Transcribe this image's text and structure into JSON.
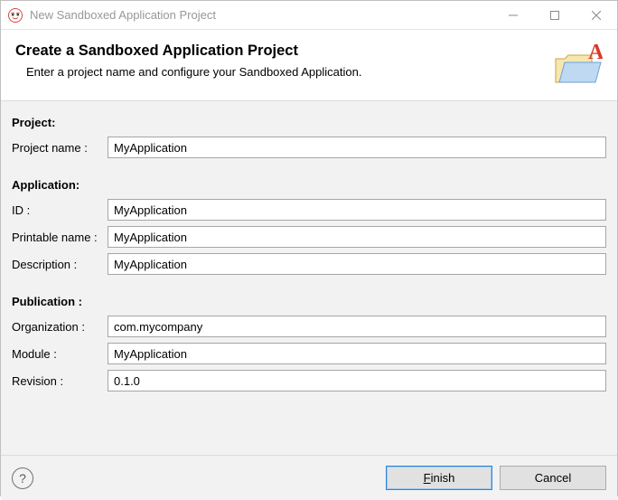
{
  "window": {
    "title": "New Sandboxed Application Project"
  },
  "header": {
    "title": "Create a Sandboxed Application Project",
    "subtitle": "Enter a project name and configure your Sandboxed Application."
  },
  "sections": {
    "project": {
      "label": "Project:",
      "name_label": "Project name :",
      "name_value": "MyApplication"
    },
    "application": {
      "label": "Application:",
      "id_label": "ID :",
      "id_value": "MyApplication",
      "printable_label": "Printable name :",
      "printable_value": "MyApplication",
      "description_label": "Description :",
      "description_value": "MyApplication"
    },
    "publication": {
      "label": "Publication :",
      "org_label": "Organization :",
      "org_value": "com.mycompany",
      "module_label": "Module :",
      "module_value": "MyApplication",
      "revision_label": "Revision :",
      "revision_value": "0.1.0"
    }
  },
  "buttons": {
    "help": "?",
    "finish_prefix": "F",
    "finish_suffix": "inish",
    "cancel": "Cancel"
  }
}
